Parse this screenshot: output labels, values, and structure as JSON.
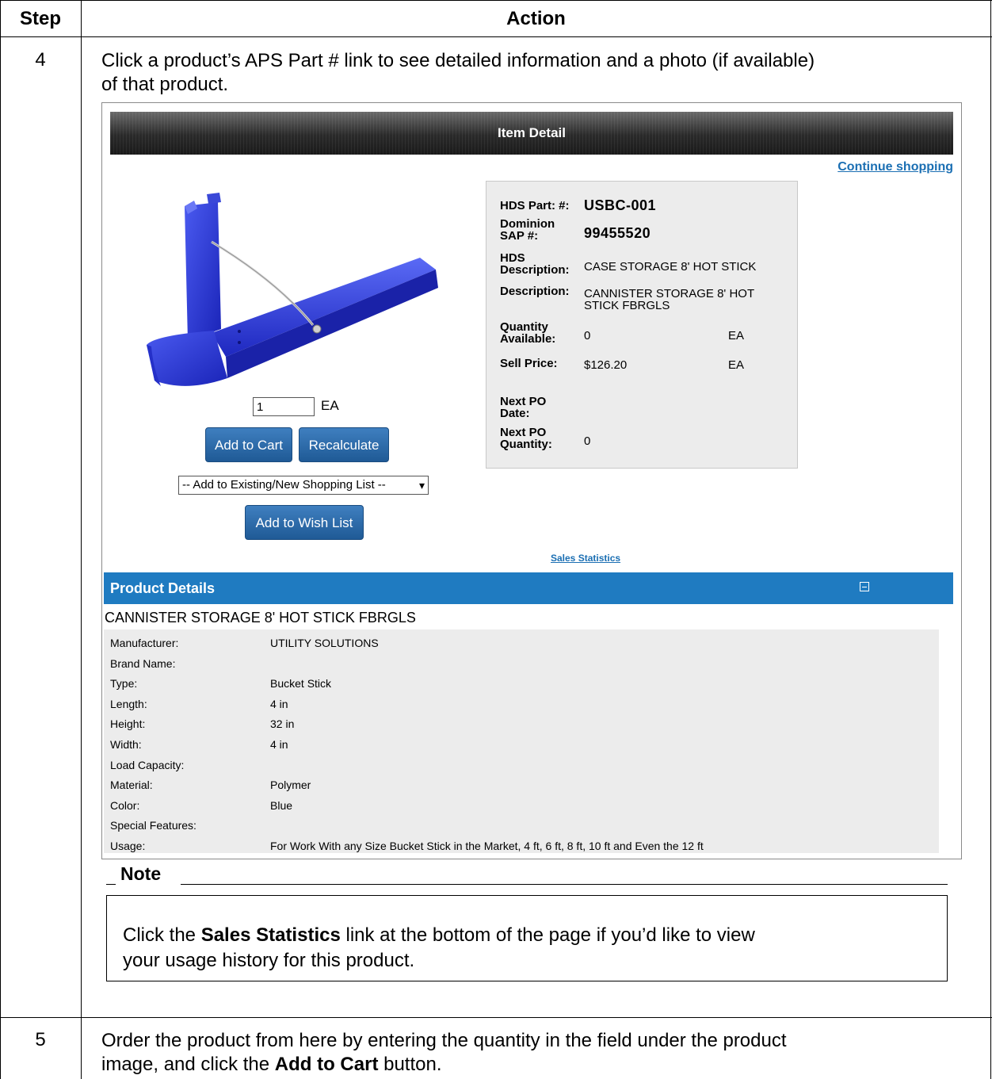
{
  "table": {
    "header_step": "Step",
    "header_action": "Action"
  },
  "rows": [
    {
      "step": "4",
      "line1": "Click a product’s APS Part # link to see detailed information and a photo (if available)",
      "line2": "of that product."
    },
    {
      "step": "5",
      "line1": "Order the product from here by entering the quantity in the field under the product",
      "line2_pre": "image, and click the ",
      "line2_bold": "Add to Cart",
      "line2_post": " button."
    }
  ],
  "screenshot": {
    "header_title": "Item Detail",
    "continue_link": "Continue shopping",
    "quantity": {
      "value": "1",
      "uom": "EA"
    },
    "buttons": {
      "add_to_cart": "Add to Cart",
      "recalculate": "Recalculate",
      "add_to_wish_list": "Add to Wish List"
    },
    "shopping_list_select": "-- Add to Existing/New Shopping List --",
    "info": {
      "hds_part_label": "HDS Part: #:",
      "hds_part_value": "USBC-001",
      "dominion_label_1": "Dominion",
      "dominion_label_2": "SAP #:",
      "dominion_value": "99455520",
      "hds_desc_label_1": "HDS",
      "hds_desc_label_2": "Description:",
      "hds_desc_value": "CASE STORAGE 8' HOT STICK",
      "desc_label": "Description:",
      "desc_value_1": "CANNISTER STORAGE 8' HOT",
      "desc_value_2": "STICK FBRGLS",
      "qty_label_1": "Quantity",
      "qty_label_2": "Available:",
      "qty_value": "0",
      "qty_uom": "EA",
      "price_label": "Sell Price:",
      "price_value": "$126.20",
      "price_uom": "EA",
      "next_po_date_label_1": "Next PO",
      "next_po_date_label_2": "Date:",
      "next_po_qty_label_1": "Next PO",
      "next_po_qty_label_2": "Quantity:",
      "next_po_qty_value": "0"
    },
    "sales_statistics_link": "Sales Statistics",
    "product_details": {
      "bar_title": "Product Details",
      "title": "CANNISTER STORAGE 8' HOT STICK FBRGLS",
      "rows": [
        {
          "k": "Manufacturer:",
          "v": "UTILITY SOLUTIONS"
        },
        {
          "k": "Brand Name:",
          "v": ""
        },
        {
          "k": "Type:",
          "v": "Bucket Stick"
        },
        {
          "k": "Length:",
          "v": "4 in"
        },
        {
          "k": "Height:",
          "v": "32 in"
        },
        {
          "k": "Width:",
          "v": "4 in"
        },
        {
          "k": "Load Capacity:",
          "v": ""
        },
        {
          "k": "Material:",
          "v": "Polymer"
        },
        {
          "k": "Color:",
          "v": "Blue"
        },
        {
          "k": "Special Features:",
          "v": ""
        },
        {
          "k": "Usage:",
          "v": "For Work With any Size Bucket Stick in the Market, 4 ft, 6 ft, 8 ft, 10 ft and Even the 12 ft"
        }
      ]
    }
  },
  "note": {
    "title": "Note",
    "pre": "Click the ",
    "bold": "Sales Statistics",
    "post": " link at the bottom of the page if you’d like to view",
    "line2": "your usage history for this product."
  },
  "colors": {
    "accent_blue": "#1f7bc1",
    "product_blue": "#2433d6",
    "link": "#1b6fb3"
  }
}
